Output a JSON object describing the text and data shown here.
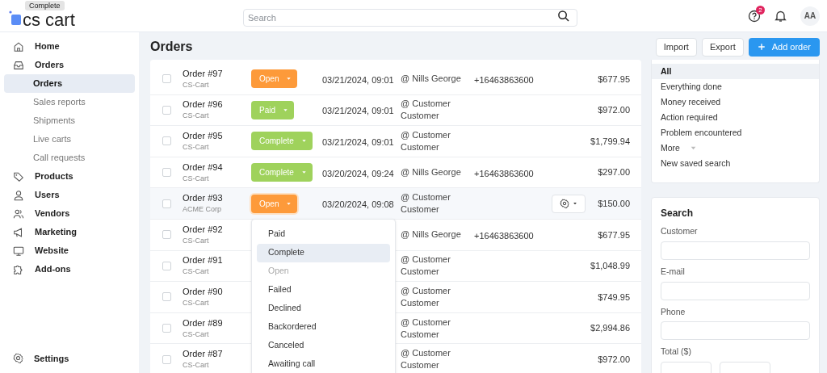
{
  "tooltip": "Complete",
  "logo": "cs cart",
  "search": {
    "placeholder": "Search"
  },
  "notifications_badge": "2",
  "avatar": "AA",
  "sidebar": {
    "items": [
      {
        "label": "Home",
        "selected": false
      },
      {
        "label": "Orders",
        "selected": false,
        "children": [
          {
            "label": "Orders",
            "selected": true
          },
          {
            "label": "Sales reports",
            "selected": false
          },
          {
            "label": "Shipments",
            "selected": false
          },
          {
            "label": "Live carts",
            "selected": false
          },
          {
            "label": "Call requests",
            "selected": false
          }
        ]
      },
      {
        "label": "Products",
        "selected": false
      },
      {
        "label": "Users",
        "selected": false
      },
      {
        "label": "Vendors",
        "selected": false
      },
      {
        "label": "Marketing",
        "selected": false
      },
      {
        "label": "Website",
        "selected": false
      },
      {
        "label": "Add-ons",
        "selected": false
      }
    ],
    "settings": "Settings"
  },
  "page_title": "Orders",
  "actions": [
    {
      "label": "Import",
      "kind": "plain"
    },
    {
      "label": "Export",
      "kind": "plain"
    },
    {
      "label": "Add order",
      "kind": "primary"
    }
  ],
  "orders": [
    {
      "order": "Order #97",
      "vendor": "CS-Cart",
      "status": {
        "label": "Open",
        "kind": "open"
      },
      "date": "03/21/2024, 09:01",
      "customer": "@ Nills George",
      "phone": "+16463863600",
      "total": "$677.95",
      "highlighted": false,
      "checked": false
    },
    {
      "order": "Order #96",
      "vendor": "CS-Cart",
      "status": {
        "label": "Paid",
        "kind": "paid"
      },
      "date": "03/21/2024, 09:01",
      "customer": "@ Customer Customer",
      "total": "$972.00",
      "highlighted": false,
      "checked": false
    },
    {
      "order": "Order #95",
      "vendor": "CS-Cart",
      "status": {
        "label": "Complete",
        "kind": "complete"
      },
      "date": "03/21/2024, 09:01",
      "customer": "@ Customer Customer",
      "total": "$1,799.94",
      "highlighted": false,
      "checked": false
    },
    {
      "order": "Order #94",
      "vendor": "CS-Cart",
      "status": {
        "label": "Complete",
        "kind": "complete"
      },
      "date": "03/20/2024, 09:24",
      "customer": "@ Nills George",
      "phone": "+16463863600",
      "total": "$297.00",
      "highlighted": false,
      "checked": false
    },
    {
      "order": "Order #93",
      "vendor": "ACME Corp",
      "status": {
        "label": "Open",
        "kind": "open"
      },
      "date": "03/20/2024, 09:08",
      "customer": "@ Customer Customer",
      "total": "$150.00",
      "highlighted": true,
      "menu_open": true,
      "checked": false
    },
    {
      "order": "Order #92",
      "vendor": "CS-Cart",
      "customer": "@ Nills George",
      "phone": "+16463863600",
      "total": "$677.95",
      "highlighted": false,
      "checked": false
    },
    {
      "order": "Order #91",
      "vendor": "CS-Cart",
      "customer": "@ Customer Customer",
      "total": "$1,048.99",
      "highlighted": false,
      "checked": false
    },
    {
      "order": "Order #90",
      "vendor": "CS-Cart",
      "customer": "@ Customer Customer",
      "total": "$749.95",
      "highlighted": false,
      "checked": false
    },
    {
      "order": "Order #89",
      "vendor": "CS-Cart",
      "customer": "@ Customer Customer",
      "total": "$2,994.86",
      "highlighted": false,
      "checked": false
    },
    {
      "order": "Order #87",
      "vendor": "CS-Cart",
      "customer": "@ Customer Customer",
      "total": "$972.00",
      "highlighted": false,
      "checked": false
    }
  ],
  "status_menu": [
    {
      "label": "Paid",
      "selected": false,
      "disabled": false
    },
    {
      "label": "Complete",
      "selected": true,
      "disabled": false
    },
    {
      "label": "Open",
      "selected": false,
      "disabled": true
    },
    {
      "label": "Failed",
      "selected": false,
      "disabled": false
    },
    {
      "label": "Declined",
      "selected": false,
      "disabled": false
    },
    {
      "label": "Backordered",
      "selected": false,
      "disabled": false
    },
    {
      "label": "Canceled",
      "selected": false,
      "disabled": false
    },
    {
      "label": "Awaiting call",
      "selected": false,
      "disabled": false
    }
  ],
  "saved_searches": [
    {
      "label": "All",
      "selected": true
    },
    {
      "label": "Everything done",
      "selected": false
    },
    {
      "label": "Money received",
      "selected": false
    },
    {
      "label": "Action required",
      "selected": false
    },
    {
      "label": "Problem encountered",
      "selected": false
    },
    {
      "label": "More",
      "selected": false,
      "kind": "more"
    },
    {
      "label": "New saved search",
      "selected": false
    }
  ],
  "search_panel": {
    "title": "Search",
    "fields": [
      {
        "label": "Customer",
        "kind": "text"
      },
      {
        "label": "E-mail",
        "kind": "text"
      },
      {
        "label": "Phone",
        "kind": "text"
      },
      {
        "label": "Total ($)",
        "kind": "range"
      }
    ]
  }
}
